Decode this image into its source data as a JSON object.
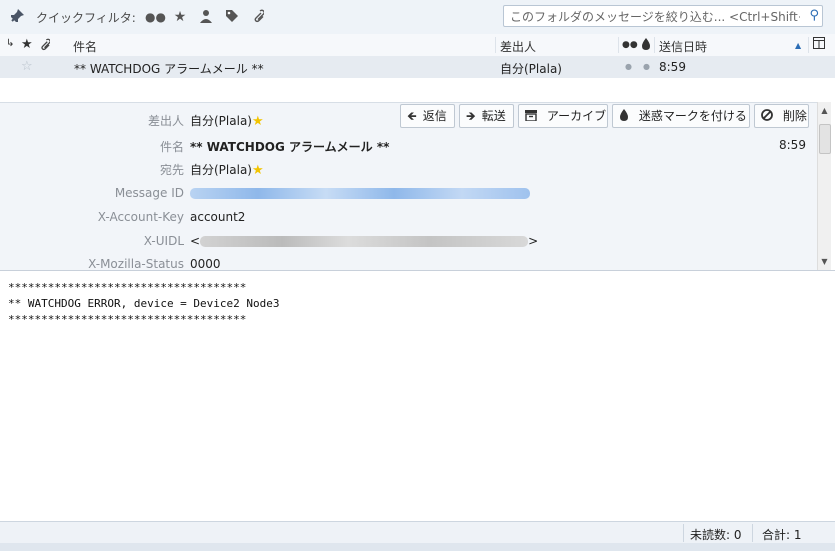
{
  "quick_filter": {
    "label": "クイックフィルタ:",
    "search_placeholder": "このフォルダのメッセージを絞り込む... <Ctrl+Shift+K>"
  },
  "thread_columns": {
    "subject": "件名",
    "from": "差出人",
    "date": "送信日時"
  },
  "message_row": {
    "subject": "** WATCHDOG アラームメール **",
    "from": "自分(Plala)",
    "time": "8:59"
  },
  "header_labels": {
    "from": "差出人",
    "subject": "件名",
    "to": "宛先",
    "message_id": "Message ID",
    "account_key": "X-Account-Key",
    "uidl": "X-UIDL",
    "mozilla_status": "X-Mozilla-Status"
  },
  "header_values": {
    "from": "自分(Plala)",
    "subject": "** WATCHDOG アラームメール **",
    "time": "8:59",
    "to": "自分(Plala)",
    "account_key": "account2",
    "uidl_open": "<",
    "uidl_close": ">",
    "mozilla_status": "0000"
  },
  "buttons": {
    "reply": "返信",
    "forward": "転送",
    "archive": "アーカイブ",
    "junk": "迷惑マークを付ける",
    "delete": "削除"
  },
  "body_lines": [
    "************************************",
    "** WATCHDOG ERROR, device = Device2 Node3",
    "************************************"
  ],
  "status": {
    "unread": "未読数: 0",
    "total": "合計: 1"
  },
  "colors": {
    "accent": "#2c6db5",
    "star": "#f2c400"
  }
}
